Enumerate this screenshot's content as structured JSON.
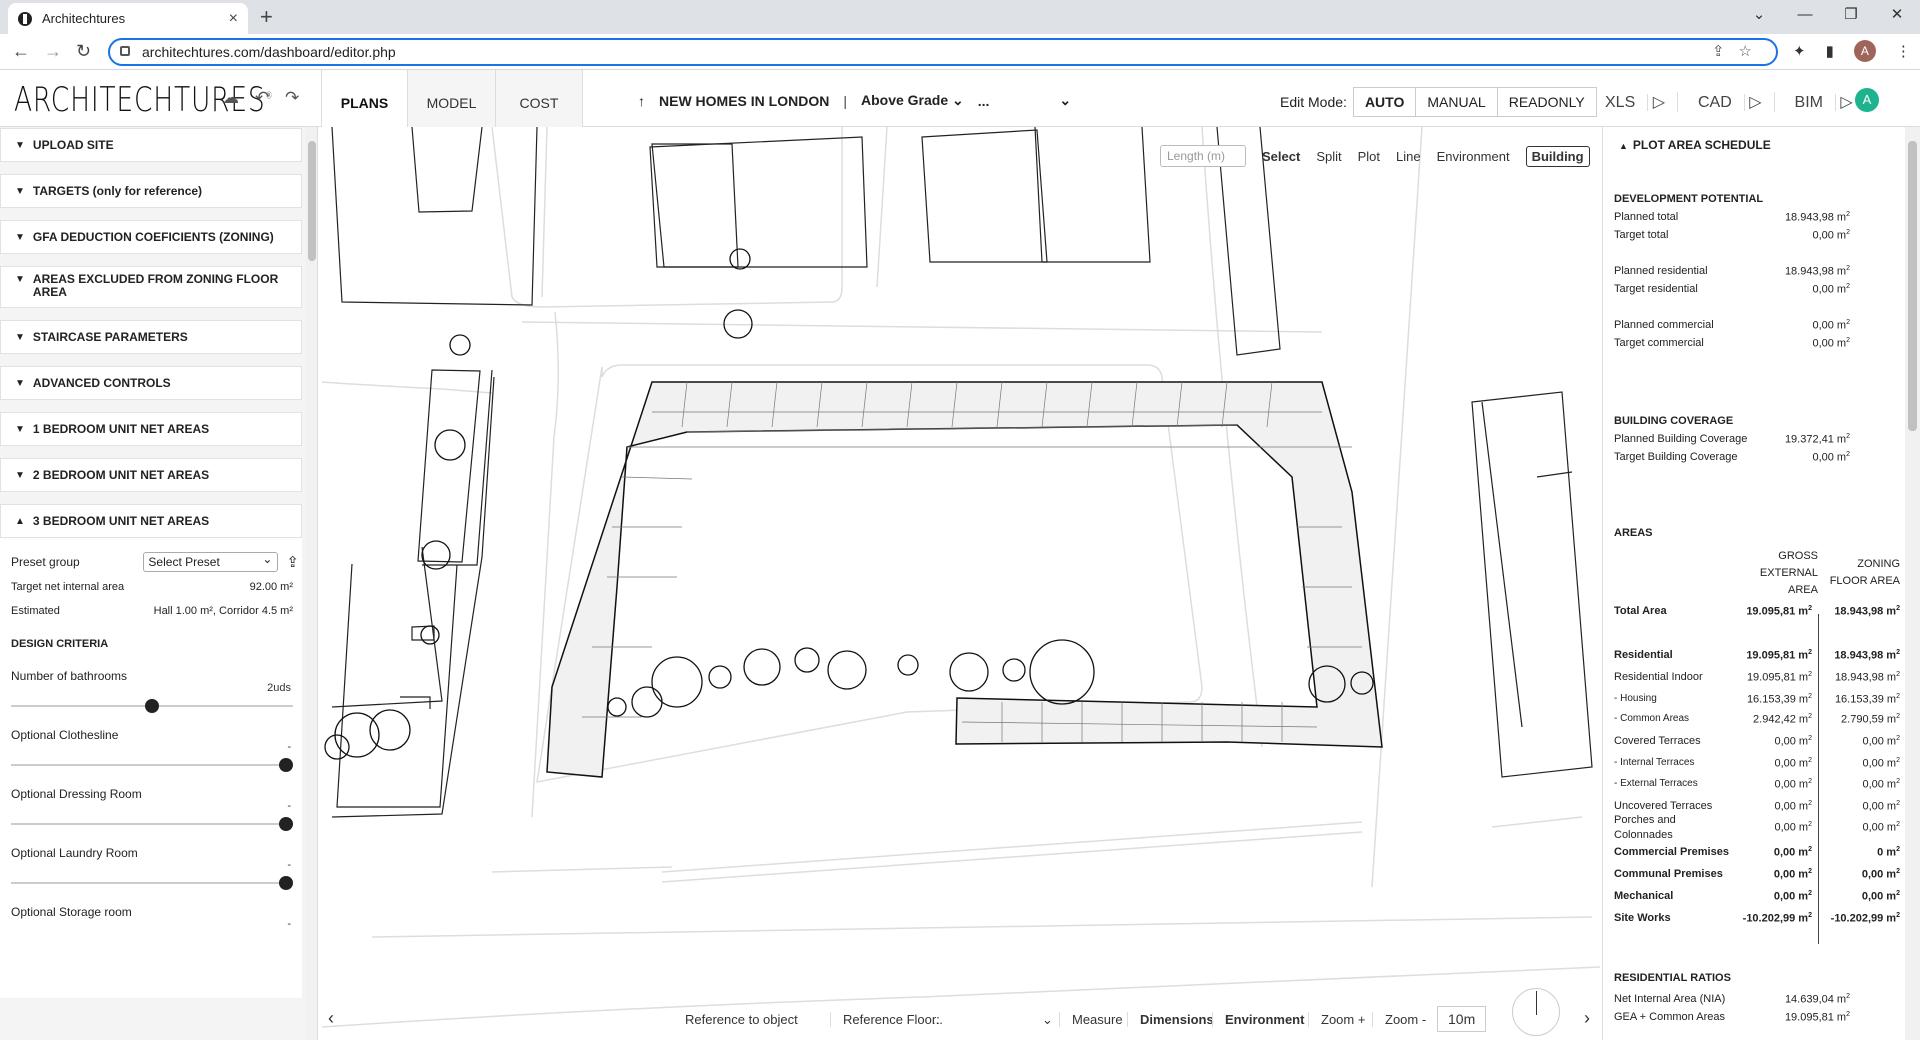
{
  "browser": {
    "tab_title": "Architechtures",
    "url": "architechtures.com/dashboard/editor.php",
    "profile_initial": "A"
  },
  "app": {
    "logo": "ARCHITECHTURES",
    "tabs": [
      "PLANS",
      "MODEL",
      "COST"
    ],
    "project_title": "NEW HOMES IN LONDON",
    "level": "Above Grade",
    "level_more": "...",
    "edit_mode_label": "Edit Mode:",
    "edit_modes": [
      "AUTO",
      "MANUAL",
      "READONLY"
    ],
    "exports": [
      "XLS",
      "CAD",
      "BIM"
    ],
    "user_initial": "A"
  },
  "left": {
    "sections": [
      "UPLOAD SITE",
      "TARGETS (only for reference)",
      "GFA DEDUCTION COEFICIENTS (ZONING)",
      "AREAS EXCLUDED FROM ZONING FLOOR AREA",
      "STAIRCASE PARAMETERS",
      "ADVANCED CONTROLS",
      "1 BEDROOM UNIT NET AREAS",
      "2 BEDROOM UNIT NET AREAS",
      "3 BEDROOM UNIT NET AREAS"
    ],
    "preset_label": "Preset group",
    "preset_value": "Select Preset",
    "target_label": "Target net internal area",
    "target_value": "92.00 m²",
    "estimated_label": "Estimated",
    "estimated_value": "Hall 1.00 m², Corridor 4.5 m²",
    "design_criteria": "DESIGN CRITERIA",
    "bathrooms_label": "Number of bathrooms",
    "bathrooms_value": "2uds",
    "bathrooms_level": 0.5,
    "options": [
      "Optional Clothesline",
      "Optional Dressing Room",
      "Optional Laundry Room",
      "Optional Storage room"
    ],
    "option_value": "-"
  },
  "canvas": {
    "length_placeholder": "Length (m)",
    "modes": [
      "Select",
      "Split",
      "Plot",
      "Line",
      "Environment",
      "Building"
    ],
    "bottom": {
      "reference_object": "Reference to object",
      "reference_floor_label": "Reference Floor:",
      "reference_floor_value": "...",
      "measure": "Measure",
      "dimensions": "Dimensions",
      "environment": "Environment",
      "zoom_in": "Zoom +",
      "zoom_out": "Zoom -",
      "scale": "10m"
    }
  },
  "right": {
    "title": "PLOT AREA SCHEDULE",
    "dev_potential": "DEVELOPMENT POTENTIAL",
    "dev_rows": [
      [
        "Planned total",
        "18.943,98 m"
      ],
      [
        "Target total",
        "0,00 m"
      ],
      [
        "Planned residential",
        "18.943,98 m"
      ],
      [
        "Target residential",
        "0,00 m"
      ],
      [
        "Planned commercial",
        "0,00 m"
      ],
      [
        "Target commercial",
        "0,00 m"
      ]
    ],
    "coverage_title": "BUILDING COVERAGE",
    "coverage_rows": [
      [
        "Planned Building Coverage",
        "19.372,41 m"
      ],
      [
        "Target Building Coverage",
        "0,00 m"
      ]
    ],
    "areas_title": "AREAS",
    "col_gross": "GROSS EXTERNAL AREA",
    "col_zoning": "ZONING FLOOR AREA",
    "area_rows": [
      {
        "n": "Total Area",
        "g": "19.095,81 m",
        "z": "18.943,98 m",
        "b": true
      },
      {
        "n": "Residential",
        "g": "19.095,81 m",
        "z": "18.943,98 m",
        "b": true
      },
      {
        "n": "Residential Indoor",
        "g": "19.095,81 m",
        "z": "18.943,98 m",
        "b": false
      },
      {
        "n": "- Housing",
        "g": "16.153,39 m",
        "z": "16.153,39 m",
        "b": false
      },
      {
        "n": "- Common Areas",
        "g": "2.942,42 m",
        "z": "2.790,59 m",
        "b": false
      },
      {
        "n": "Covered Terraces",
        "g": "0,00 m",
        "z": "0,00 m",
        "b": false
      },
      {
        "n": "- Internal Terraces",
        "g": "0,00 m",
        "z": "0,00 m",
        "b": false
      },
      {
        "n": "- External Terraces",
        "g": "0,00 m",
        "z": "0,00 m",
        "b": false
      },
      {
        "n": "Uncovered Terraces",
        "g": "0,00 m",
        "z": "0,00 m",
        "b": false
      },
      {
        "n": "Porches and Colonnades",
        "g": "0,00 m",
        "z": "0,00 m",
        "b": false
      },
      {
        "n": "Commercial Premises",
        "g": "0,00 m",
        "z": "0 m",
        "b": true
      },
      {
        "n": "Communal Premises",
        "g": "0,00 m",
        "z": "0,00 m",
        "b": true
      },
      {
        "n": "Mechanical",
        "g": "0,00 m",
        "z": "0,00 m",
        "b": true
      },
      {
        "n": "Site Works",
        "g": "-10.202,99 m",
        "z": "-10.202,99 m",
        "b": true
      }
    ],
    "ratios_title": "RESIDENTIAL RATIOS",
    "ratio_rows": [
      [
        "Net Internal Area (NIA)",
        "14.639,04 m"
      ],
      [
        "GEA + Common Areas",
        "19.095,81 m"
      ]
    ],
    "sup": "2"
  }
}
